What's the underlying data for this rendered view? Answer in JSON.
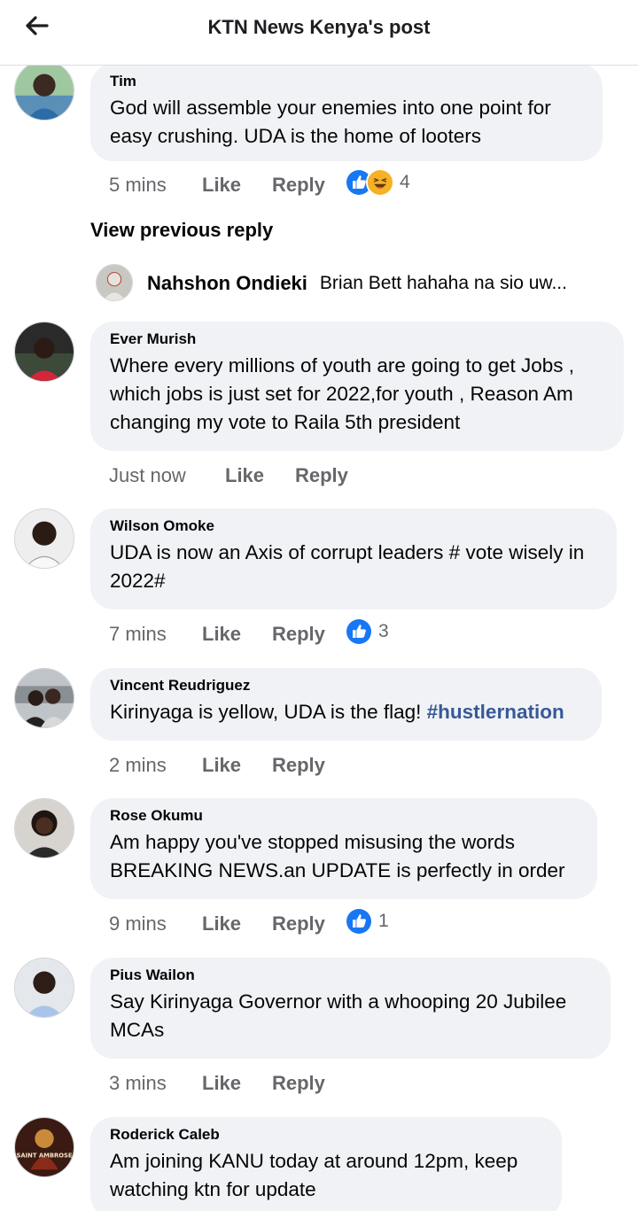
{
  "header": {
    "title": "KTN News Kenya's post"
  },
  "comments": [
    {
      "author": "Tim",
      "text": "God will assemble your enemies into one point for easy crushing. UDA is the home of looters",
      "time": "5 mins",
      "like": "Like",
      "reply": "Reply",
      "reaction_count": "4",
      "reactions": [
        "like-reaction-icon",
        "haha-reaction-icon"
      ]
    },
    {
      "author": "Ever Murish",
      "text": "Where every millions of youth are going to get Jobs , which jobs is just set for 2022,for youth , Reason Am changing my vote to Raila  5th president",
      "time": "Just now",
      "like": "Like",
      "reply": "Reply"
    },
    {
      "author": "Wilson Omoke",
      "text": "UDA is now an Axis of corrupt leaders # vote wisely in 2022#",
      "time": "7 mins",
      "like": "Like",
      "reply": "Reply",
      "reaction_count": "3",
      "reactions": [
        "like-reaction-icon"
      ]
    },
    {
      "author": "Vincent Reudriguez",
      "text": "Kirinyaga is yellow, UDA is the flag! ",
      "hashtag": "#hustlernation",
      "time": "2 mins",
      "like": "Like",
      "reply": "Reply"
    },
    {
      "author": "Rose Okumu",
      "text": "Am happy you've stopped misusing the words BREAKING NEWS.an UPDATE is perfectly in order",
      "time": "9 mins",
      "like": "Like",
      "reply": "Reply",
      "reaction_count": "1",
      "reactions": [
        "like-reaction-icon"
      ]
    },
    {
      "author": "Pius Wailon",
      "text": "Say Kirinyaga Governor with a whooping 20 Jubilee MCAs",
      "time": "3 mins",
      "like": "Like",
      "reply": "Reply"
    },
    {
      "author": "Roderick Caleb",
      "text": "Am joining KANU today at around 12pm, keep watching ktn for update",
      "avatar_text": "SAINT AMBROSE"
    }
  ],
  "view_previous_reply": "View previous reply",
  "collapsed_reply": {
    "author": "Nahshon Ondieki",
    "snippet": "Brian Bett hahaha na sio uw..."
  },
  "colors": {
    "bubble": "#f0f2f5",
    "meta_gray": "#65676b",
    "like_blue": "#1877f2",
    "hashtag": "#385898"
  }
}
